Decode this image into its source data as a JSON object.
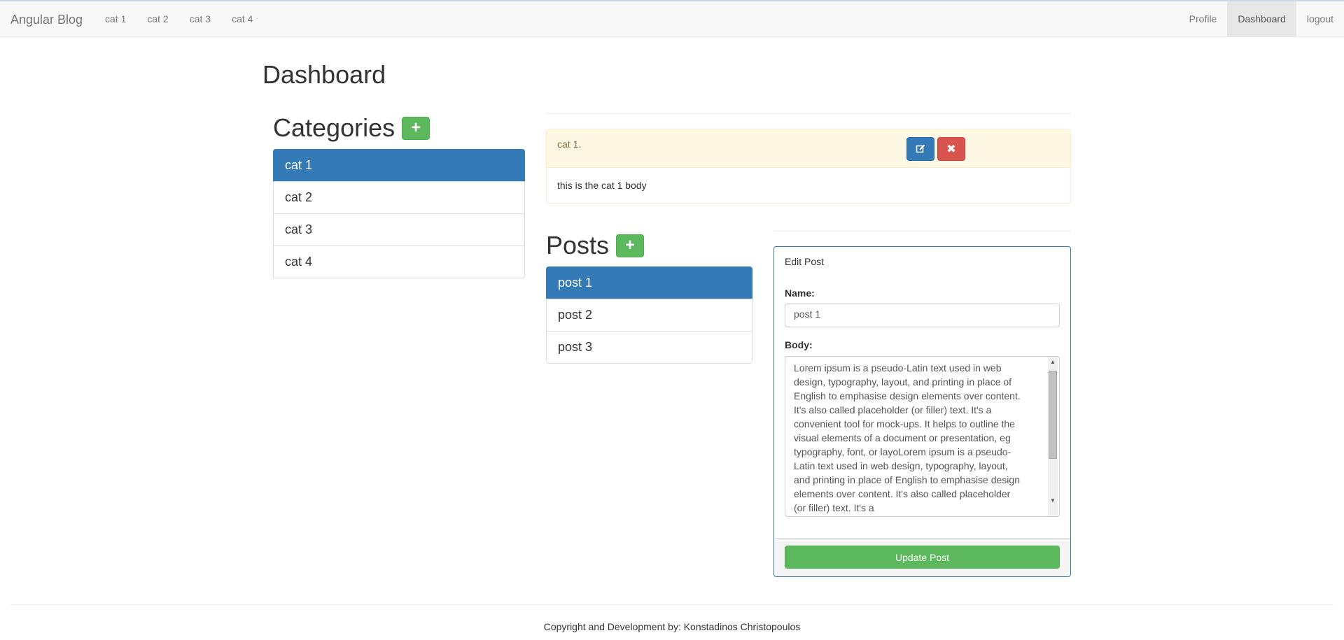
{
  "navbar": {
    "brand": "Angular Blog",
    "left_items": [
      {
        "label": "cat 1"
      },
      {
        "label": "cat 2"
      },
      {
        "label": "cat 3"
      },
      {
        "label": "cat 4"
      }
    ],
    "right_items": [
      {
        "label": "Profile",
        "active": false
      },
      {
        "label": "Dashboard",
        "active": true
      },
      {
        "label": "logout",
        "active": false
      }
    ]
  },
  "page": {
    "title": "Dashboard"
  },
  "categories": {
    "title": "Categories",
    "add_icon": "plus-icon",
    "items": [
      {
        "label": "cat 1",
        "active": true
      },
      {
        "label": "cat 2",
        "active": false
      },
      {
        "label": "cat 3",
        "active": false
      },
      {
        "label": "cat 4",
        "active": false
      }
    ]
  },
  "category_detail": {
    "title": "cat 1.",
    "body": "this is the cat 1 body",
    "edit_icon": "edit-icon",
    "delete_icon": "close-icon"
  },
  "posts": {
    "title": "Posts",
    "add_icon": "plus-icon",
    "items": [
      {
        "label": "post 1",
        "active": true
      },
      {
        "label": "post 2",
        "active": false
      },
      {
        "label": "post 3",
        "active": false
      }
    ]
  },
  "edit_post": {
    "title": "Edit Post",
    "name_label": "Name:",
    "name_value": "post 1",
    "body_label": "Body:",
    "body_value": "Lorem ipsum is a pseudo-Latin text used in web design, typography, layout, and printing in place of English to emphasise design elements over content. It's also called placeholder (or filler) text. It's a convenient tool for mock-ups. It helps to outline the visual elements of a document or presentation, eg typography, font, or layoLorem ipsum is a pseudo-Latin text used in web design, typography, layout, and printing in place of English to emphasise design elements over content. It's also called placeholder (or filler) text. It's a",
    "update_label": "Update Post"
  },
  "footer": {
    "text": "Copyright and Development by: Konstadinos Christopoulos"
  },
  "colors": {
    "primary": "#337ab7",
    "success": "#5cb85c",
    "danger": "#d9534f",
    "warning_bg": "#fcf8e3"
  }
}
